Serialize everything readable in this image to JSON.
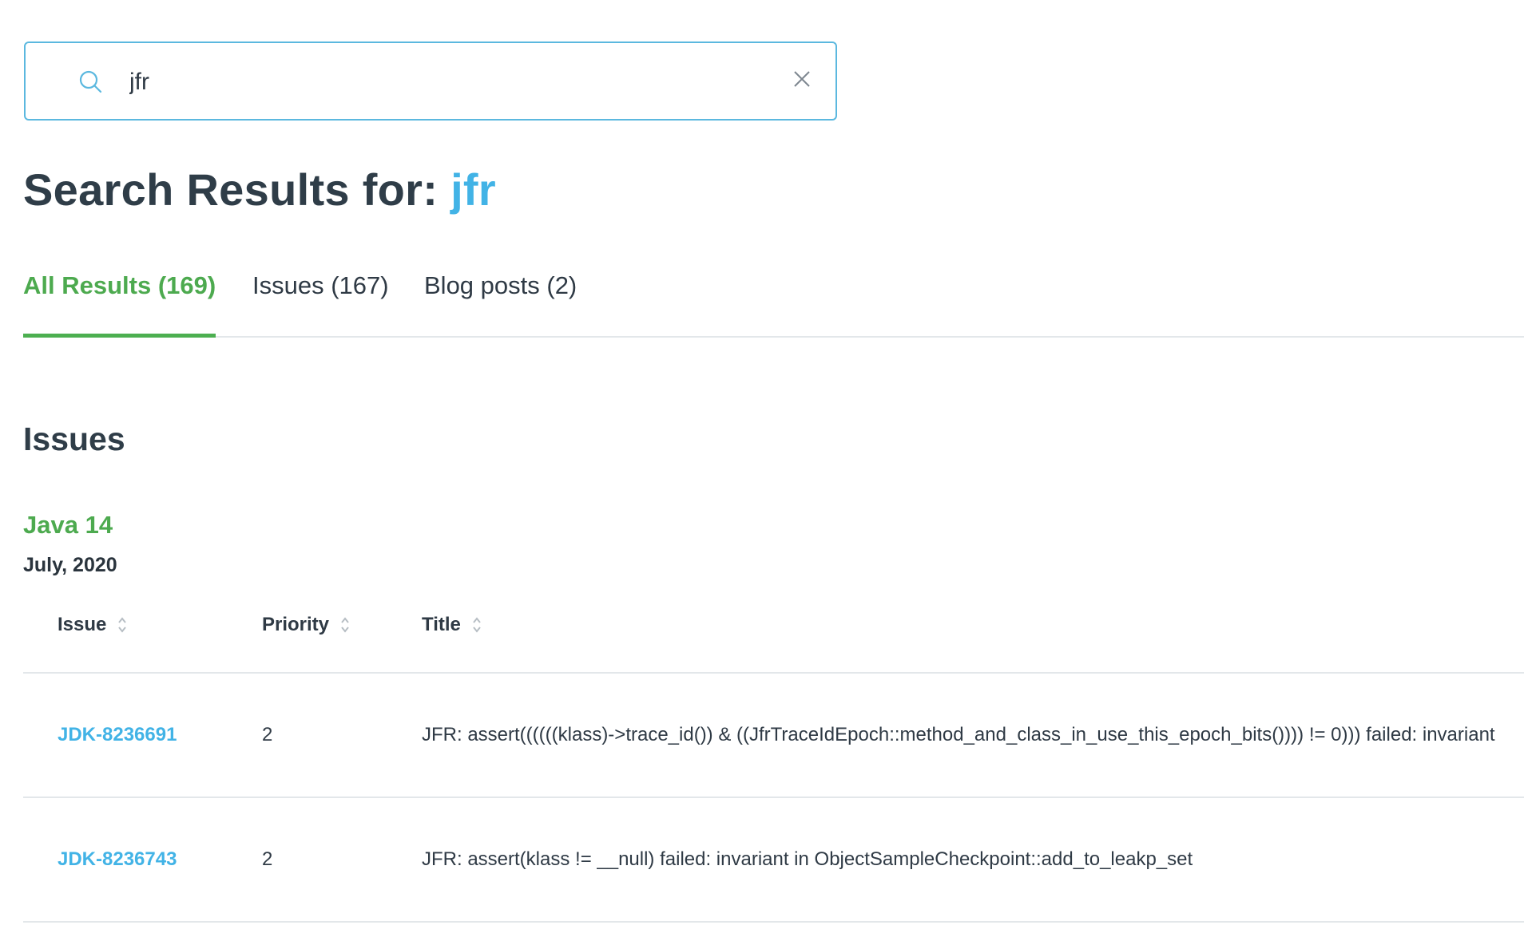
{
  "search": {
    "value": "jfr",
    "placeholder": ""
  },
  "header": {
    "title_prefix": "Search Results for:",
    "query": "jfr"
  },
  "tabs": [
    {
      "label": "All Results (169)",
      "active": true
    },
    {
      "label": "Issues (167)",
      "active": false
    },
    {
      "label": "Blog posts (2)",
      "active": false
    }
  ],
  "section": {
    "heading": "Issues",
    "group_title": "Java 14",
    "group_date": "July, 2020"
  },
  "table": {
    "columns": [
      "Issue",
      "Priority",
      "Title"
    ],
    "rows": [
      {
        "issue": "JDK-8236691",
        "priority": "2",
        "title": "JFR: assert((((((klass)->trace_id()) & ((JfrTraceIdEpoch::method_and_class_in_use_this_epoch_bits()))) != 0))) failed: invariant"
      },
      {
        "issue": "JDK-8236743",
        "priority": "2",
        "title": "JFR: assert(klass != __null) failed: invariant in ObjectSampleCheckpoint::add_to_leakp_set"
      }
    ]
  },
  "colors": {
    "accent_blue": "#42b3e6",
    "accent_green": "#4caf50",
    "text_dark": "#2f3d48",
    "border": "#e3e7ea"
  },
  "icons": {
    "search": "search-icon",
    "clear": "close-icon",
    "sort": "sort-icon"
  }
}
